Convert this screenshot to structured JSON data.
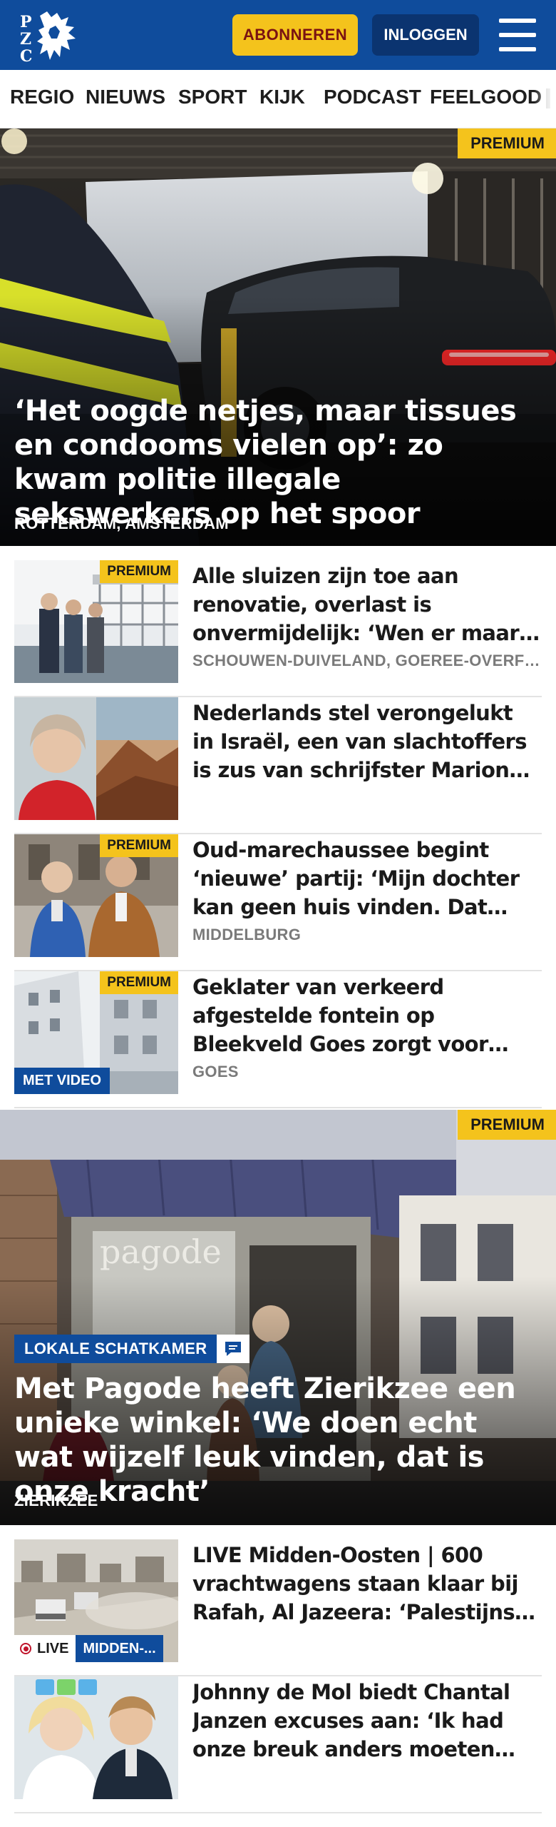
{
  "header": {
    "logo_text": "PZC",
    "subscribe_label": "ABONNEREN",
    "login_label": "INLOGGEN",
    "menu_icon": "hamburger-menu-icon"
  },
  "nav": {
    "items": [
      "REGIO",
      "NIEUWS",
      "SPORT",
      "KIJK",
      "PODCAST",
      "FEELGOOD"
    ]
  },
  "premium_label": "PREMIUM",
  "hero1": {
    "premium": true,
    "title": "‘Het oogde netjes, maar tissues en condooms vielen op’: zo kwam politie illegale sekswerkers op het spoor",
    "location": "ROTTERDAM, AMSTERDAM"
  },
  "articles": [
    {
      "premium": true,
      "title": "Alle sluizen zijn toe aan renovatie, overlast is onvermijdelijk: ‘Wen er maar aan’",
      "location": "SCHOUWEN-DUIVELAND, GOEREE-OVERFLAKKEE"
    },
    {
      "premium": false,
      "title": "Nederlands stel verongelukt in Israël, een van slachtoffers is zus van schrijfster Marion Pauw",
      "location": ""
    },
    {
      "premium": true,
      "title": "Oud-marechaussee begint ‘nieuwe’ partij: ‘Mijn dochter kan geen huis vinden. Dat moet anders’",
      "location": "MIDDELBURG"
    },
    {
      "premium": true,
      "video_label": "MET VIDEO",
      "title": "Geklater van verkeerd afgestelde fontein op Bleekveld Goes zorgt voor geluidsoverlast",
      "location": "GOES"
    }
  ],
  "hero2": {
    "premium": true,
    "kicker": "LOKALE SCHATKAMER",
    "title": "Met Pagode heeft Zierikzee een unieke winkel: ‘We doen echt wat wijzelf leuk vinden, dat is onze kracht’",
    "location": "ZIERIKZEE"
  },
  "articles2": [
    {
      "live_label": "LIVE",
      "category": "MIDDEN-...",
      "title": "LIVE Midden-Oosten | 600 vrachtwagens staan klaar bij Rafah, Al Jazeera: ‘Palestijnse burgers gedood’",
      "location": ""
    },
    {
      "title": "Johnny de Mol biedt Chantal Janzen excuses aan: ‘Ik had onze breuk anders moeten aanpakken’",
      "location": ""
    }
  ],
  "colors": {
    "brand_blue": "#0f4c9c",
    "premium_yellow": "#f4c31c",
    "subscribe_text": "#7a1212",
    "location_grey": "#7a7a7a"
  }
}
